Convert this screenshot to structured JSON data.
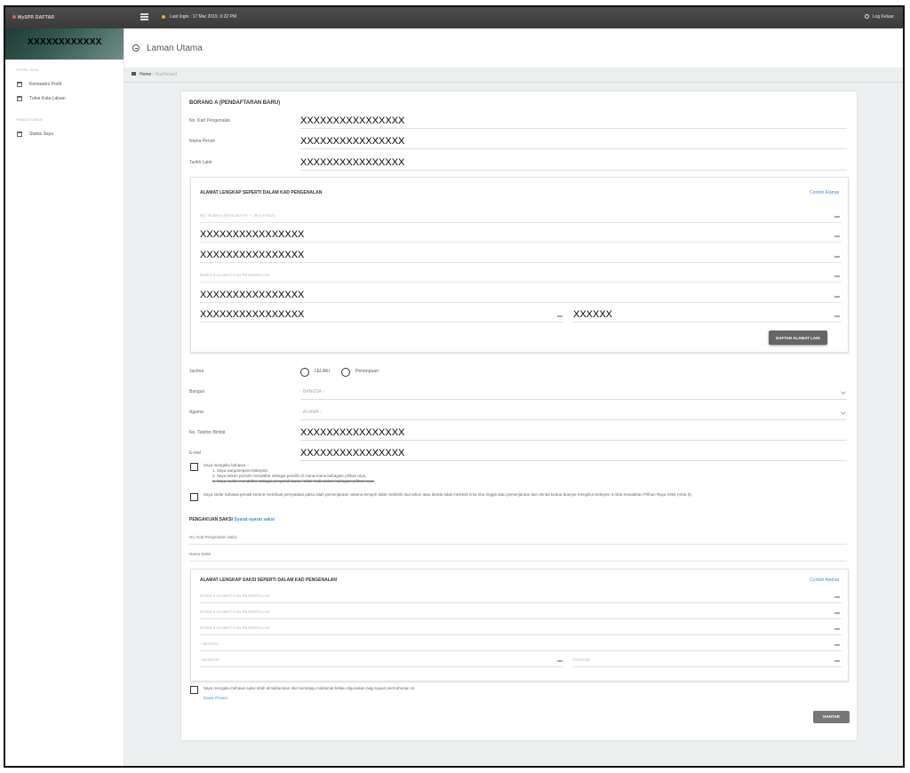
{
  "app": {
    "brand": "MySPR DAFTAR",
    "last_login": "Last login : 17 Mar 2019, 9:22 PM",
    "logout": "Log Keluar"
  },
  "sidebar": {
    "username": "XXXXXXXXXXXX",
    "sections": [
      {
        "label": "PROFIL SAYA",
        "items": [
          "Kemaskini Profil",
          "Tukar Kata Laluan"
        ]
      },
      {
        "label": "PENDAFTARAN",
        "items": [
          "Status Saya"
        ]
      }
    ]
  },
  "page": {
    "title": "Laman Utama",
    "breadcrumb": {
      "home": "Home",
      "separator": "/",
      "current": "Dashboard"
    }
  },
  "form": {
    "title": "BORANG A (PENDAFTARAN BARU)",
    "id_label": "No. Kad Pengenalan",
    "id_value": "XXXXXXXXXXXXXXXX",
    "name_label": "Nama Penuh",
    "name_value": "XXXXXXXXXXXXXXXX",
    "dob_label": "Tarikh Lahir",
    "dob_value": "XXXXXXXXXXXXXXXX",
    "address": {
      "title": "ALAMAT LENGKAP SEPERTI DALAM KAD PENGENALAN",
      "example_link": "Contoh Alamat",
      "house_placeholder": "NO. RUMAH (MASUKKAN '-' JIKA TIADA)",
      "line1": "XXXXXXXXXXXXXXXX",
      "line2": "XXXXXXXXXXXXXXXX",
      "line3_placeholder": "BARIS 3 ALAMAT KAD PENGENALAN",
      "state": "XXXXXXXXXXXXXXXX",
      "city": "XXXXXXXXXXXXXXXX",
      "postcode": "XXXXXX",
      "other_button": "DAFTAR ALAMAT LAIN"
    },
    "gender_label": "Jantina",
    "gender_options": [
      "LELAKI",
      "Perempuan"
    ],
    "race_label": "Bangsa",
    "race_value": "- BANGSA -",
    "religion_label": "Agama",
    "religion_value": "- AGAMA -",
    "phone_label": "No. Telefon Bimbit",
    "phone_value": "XXXXXXXXXXXXXXXX",
    "email_label": "E-mel",
    "email_value": "XXXXXXXXXXXXXXXX",
    "declaration_1": {
      "intro": "Saya mengaku bahawa :-",
      "items": [
        "1. Saya warganegara Malaysia",
        "2. Saya belum pernah mendaftar sebagai pemilih di mana-mana bahagian pilihan raya.",
        "3. Saya sudah mendaftar sebagai pengundi biasa / tidak hadir dalam bahagian pilihan raya."
      ]
    },
    "declaration_2": "Saya sedar bahawa penalti kerana membuat pernyataan palsu ialah pemenjaraan selama tempoh tidak melebihi dua tahun atau denda tidak melebihi lima ribu ringgit atau pemenjaraan dan denda kedua-duanya mengikut Seksyen 3 Akta Kesalahan Pilihan Raya 1954 (Akta 5).",
    "witness": {
      "title": "PENGAKUAN SAKSI",
      "terms_link": "Syarat-syarat saksi",
      "id_label": "No. Kad Pengenalan Saksi",
      "name_label": "Nama Saksi",
      "address_title": "ALAMAT LENGKAP SAKSI SEPERTI DALAM KAD PENGENALAN",
      "example_link": "Contoh Alamat",
      "line1_placeholder": "BARIS 1 ALAMAT KAD PENGENALAN",
      "line2_placeholder": "BARIS 2 ALAMAT KAD PENGENALAN",
      "line3_placeholder": "BARIS 3 ALAMAT KAD PENGENALAN",
      "state_placeholder": "- NEGERI -",
      "city_placeholder": "- BANDAR -",
      "postcode_placeholder": "POSKOD"
    },
    "consent": "Saya mengaku bahawa saksi telah dimaklumkan dan bersetuju maklumat beliau digunakan bagi tujuan permohonan ini",
    "privacy_link": "Dasar Privasi",
    "submit_button": "HANTAR"
  }
}
